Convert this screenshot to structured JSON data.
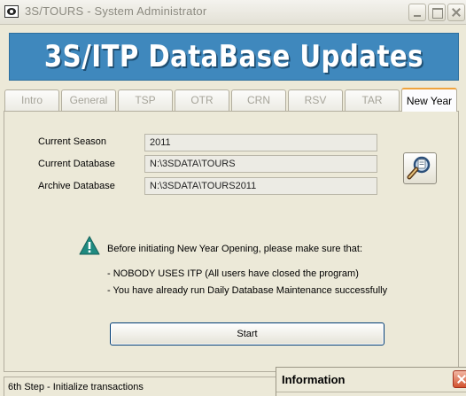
{
  "window": {
    "title": "3S/TOURS - System Administrator"
  },
  "banner": {
    "title": "3S/ITP DataBase Updates"
  },
  "tabs": [
    {
      "label": "Intro",
      "active": false
    },
    {
      "label": "General",
      "active": false
    },
    {
      "label": "TSP",
      "active": false
    },
    {
      "label": "OTR",
      "active": false
    },
    {
      "label": "CRN",
      "active": false
    },
    {
      "label": "RSV",
      "active": false
    },
    {
      "label": "TAR",
      "active": false
    },
    {
      "label": "New Year",
      "active": true
    }
  ],
  "form": {
    "current_season": {
      "label": "Current Season",
      "value": "2011"
    },
    "current_database": {
      "label": "Current Database",
      "value": "N:\\3SDATA\\TOURS"
    },
    "archive_database": {
      "label": "Archive Database",
      "value": "N:\\3SDATA\\TOURS2011"
    }
  },
  "message": {
    "intro": "Before initiating New Year Opening, please make sure that:",
    "line1": "- NOBODY USES ITP (All users have closed the program)",
    "line2": "- You have already run Daily Database Maintenance successfully"
  },
  "buttons": {
    "start_label": "Start"
  },
  "status": {
    "text": "6th Step - Initialize transactions"
  },
  "info_window": {
    "title": "Information"
  },
  "colors": {
    "banner_bg": "#3f88bd",
    "active_tab_accent": "#f0a33b",
    "warning_icon": "#1f8a80",
    "window_bg": "#ece9d8"
  },
  "icons": {
    "app": "app-eye-icon",
    "database_tool": "database-tool-icon",
    "warning": "warning-icon"
  }
}
